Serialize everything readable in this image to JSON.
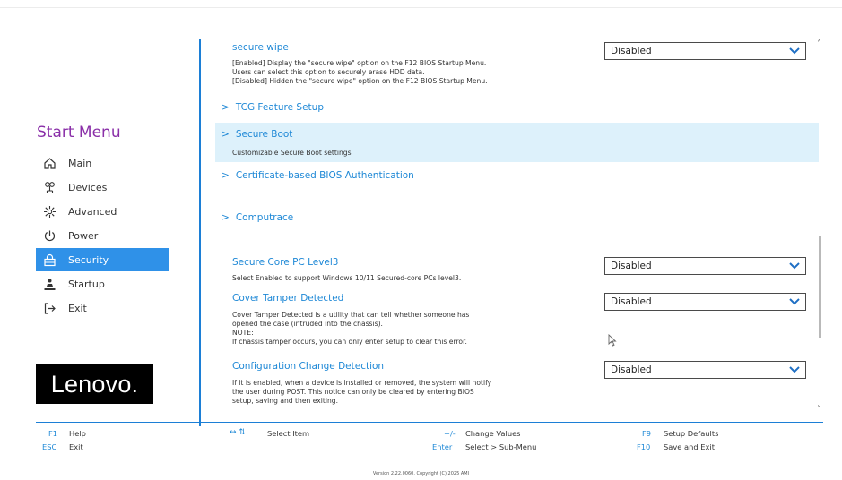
{
  "sidebar": {
    "title": "Start Menu",
    "items": [
      {
        "label": "Main",
        "icon": "home-icon"
      },
      {
        "label": "Devices",
        "icon": "devices-icon"
      },
      {
        "label": "Advanced",
        "icon": "advanced-icon"
      },
      {
        "label": "Power",
        "icon": "power-icon"
      },
      {
        "label": "Security",
        "icon": "lock-icon",
        "active": true
      },
      {
        "label": "Startup",
        "icon": "startup-icon"
      },
      {
        "label": "Exit",
        "icon": "exit-icon"
      }
    ],
    "logo": "Lenovo."
  },
  "content": {
    "secure_wipe": {
      "title": "secure wipe",
      "desc": [
        "[Enabled] Display the \"secure wipe\" option on the F12 BIOS Startup Menu.",
        "Users can select this option to securely erase HDD data.",
        "[Disabled] Hidden the \"secure wipe\" option on the F12 BIOS Startup Menu."
      ],
      "value": "Disabled"
    },
    "tcg": {
      "title": "TCG Feature Setup"
    },
    "secure_boot": {
      "title": "Secure Boot",
      "desc": "Customizable Secure Boot settings"
    },
    "cert_auth": {
      "title": "Certificate-based BIOS Authentication"
    },
    "computrace": {
      "title": "Computrace"
    },
    "secure_core": {
      "title": "Secure Core PC Level3",
      "desc": "Select Enabled to support Windows 10/11 Secured-core PCs level3.",
      "value": "Disabled"
    },
    "cover_tamper": {
      "title": "Cover Tamper Detected",
      "desc": [
        "Cover Tamper Detected is a utility that can tell whether someone has",
        "opened the case (intruded into the chassis).",
        "NOTE:",
        "If chassis tamper occurs, you can only enter setup to clear this error."
      ],
      "value": "Disabled"
    },
    "config_change": {
      "title": "Configuration Change Detection",
      "desc": [
        "If it is enabled, when a device is installed or removed, the system will notify",
        "the user during POST. This notice can only be cleared by entering BIOS",
        "setup, saving and then exiting."
      ],
      "value": "Disabled"
    }
  },
  "footer": {
    "f1_key": "F1",
    "f1_label": "Help",
    "esc_key": "ESC",
    "esc_label": "Exit",
    "arrows_key": "↔ ⇅",
    "arrows_label": "Select Item",
    "plusminus_key": "+/-",
    "plusminus_label": "Change Values",
    "enter_key": "Enter",
    "enter_label": "Select > Sub-Menu",
    "f9_key": "F9",
    "f9_label": "Setup Defaults",
    "f10_key": "F10",
    "f10_label": "Save and Exit",
    "version": "Version 2.22.0060. Copyright (C) 2025 AMI"
  },
  "colors": {
    "accent": "#1e88d6",
    "active_bg": "#2f91e8",
    "title_purple": "#8a2fa8",
    "highlight": "#ddf1fb"
  }
}
